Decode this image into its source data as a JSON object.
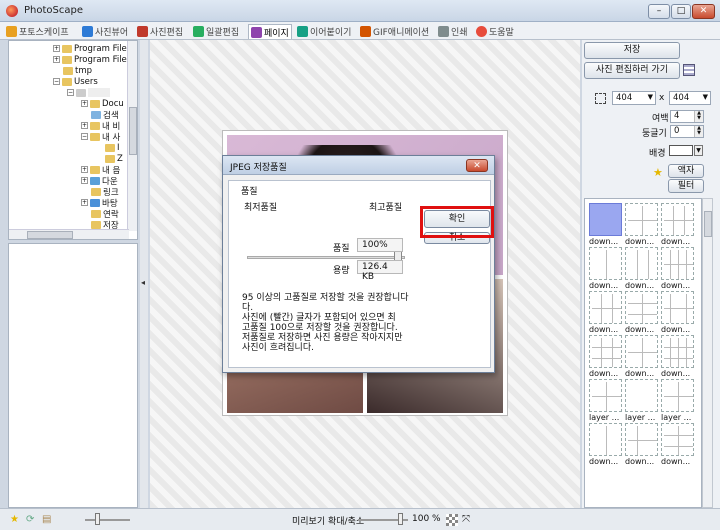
{
  "window": {
    "title": "PhotoScape",
    "min": "–",
    "max": "□",
    "close": "✕"
  },
  "tabs": [
    {
      "label": "포토스케이프",
      "icon": "photoscape-icon",
      "color": "#e8a020"
    },
    {
      "label": "사진뷰어",
      "icon": "viewer-icon",
      "color": "#2e7bd6"
    },
    {
      "label": "사진편집",
      "icon": "editor-icon",
      "color": "#c0392b"
    },
    {
      "label": "일괄편집",
      "icon": "batch-icon",
      "color": "#27ae60"
    },
    {
      "label": "페이지",
      "icon": "page-icon",
      "color": "#8e44ad"
    },
    {
      "label": "이어붙이기",
      "icon": "combine-icon",
      "color": "#16a085"
    },
    {
      "label": "GIF애니메이션",
      "icon": "gif-icon",
      "color": "#d35400"
    },
    {
      "label": "인쇄",
      "icon": "print-icon",
      "color": "#7f8c8d"
    },
    {
      "label": "도움말",
      "icon": "help-icon",
      "color": "#e74c3c"
    }
  ],
  "tree": [
    {
      "label": "Program Files",
      "indent": 2,
      "exp": "+"
    },
    {
      "label": "Program Files",
      "indent": 2,
      "exp": "+"
    },
    {
      "label": "tmp",
      "indent": 2,
      "exp": ""
    },
    {
      "label": "Users",
      "indent": 2,
      "exp": "−"
    },
    {
      "label": "",
      "indent": 3,
      "exp": "−"
    },
    {
      "label": "Docu",
      "indent": 4,
      "exp": "+"
    },
    {
      "label": "검색",
      "indent": 4,
      "exp": ""
    },
    {
      "label": "내 비",
      "indent": 4,
      "exp": "+"
    },
    {
      "label": "내 사",
      "indent": 4,
      "exp": "−"
    },
    {
      "label": "I",
      "indent": 5,
      "exp": ""
    },
    {
      "label": "Z",
      "indent": 5,
      "exp": ""
    },
    {
      "label": "내 음",
      "indent": 4,
      "exp": "+"
    },
    {
      "label": "다운",
      "indent": 4,
      "exp": "+"
    },
    {
      "label": "링크",
      "indent": 4,
      "exp": ""
    },
    {
      "label": "바탕",
      "indent": 4,
      "exp": "+"
    },
    {
      "label": "연락",
      "indent": 4,
      "exp": ""
    },
    {
      "label": "저장",
      "indent": 4,
      "exp": ""
    }
  ],
  "splitter_arrow": "◂",
  "dialog": {
    "title": "JPEG 저장품질",
    "close": "✕",
    "quality_group": "품질",
    "min_label": "최저품질",
    "max_label": "최고품질",
    "quality_label": "품질",
    "quality_value": "100%",
    "size_label": "용량",
    "size_value": "126.4 KB",
    "ok": "확인",
    "cancel": "취소",
    "note": [
      "95 이상의 고품질로 저장할 것을 권장합니다",
      "다.",
      "사진에 (빨간) 글자가 포함되어 있으면 최",
      "고품질 100으로 저장할 것을 권장합니다.",
      "저품질로 저장하면 사진 용량은 작아지지만",
      "사진이 흐려집니다."
    ]
  },
  "right": {
    "save": "저장",
    "go_edit": "사진 편집하러 가기",
    "width": "404",
    "x": "x",
    "height": "404",
    "margin_label": "여백",
    "margin_value": "4",
    "round_label": "둥글기",
    "round_value": "0",
    "border_label": "배경",
    "frame_btn": "액자",
    "filter_btn": "필터"
  },
  "layouts": [
    {
      "caption": "down...",
      "selected": true
    },
    {
      "caption": "down...",
      "selected": false
    },
    {
      "caption": "down...",
      "selected": false
    },
    {
      "caption": "down...",
      "selected": false
    },
    {
      "caption": "down...",
      "selected": false
    },
    {
      "caption": "down...",
      "selected": false
    },
    {
      "caption": "down...",
      "selected": false
    },
    {
      "caption": "down...",
      "selected": false
    },
    {
      "caption": "down...",
      "selected": false
    },
    {
      "caption": "down...",
      "selected": false
    },
    {
      "caption": "down...",
      "selected": false
    },
    {
      "caption": "down...",
      "selected": false
    },
    {
      "caption": "layer ...",
      "selected": false
    },
    {
      "caption": "layer ...",
      "selected": false
    },
    {
      "caption": "layer ...",
      "selected": false
    },
    {
      "caption": "down...",
      "selected": false
    },
    {
      "caption": "down...",
      "selected": false
    },
    {
      "caption": "down...",
      "selected": false
    }
  ],
  "statusbar": {
    "preview_label": "미리보기 확대/축소",
    "zoom_value": "100 %"
  }
}
